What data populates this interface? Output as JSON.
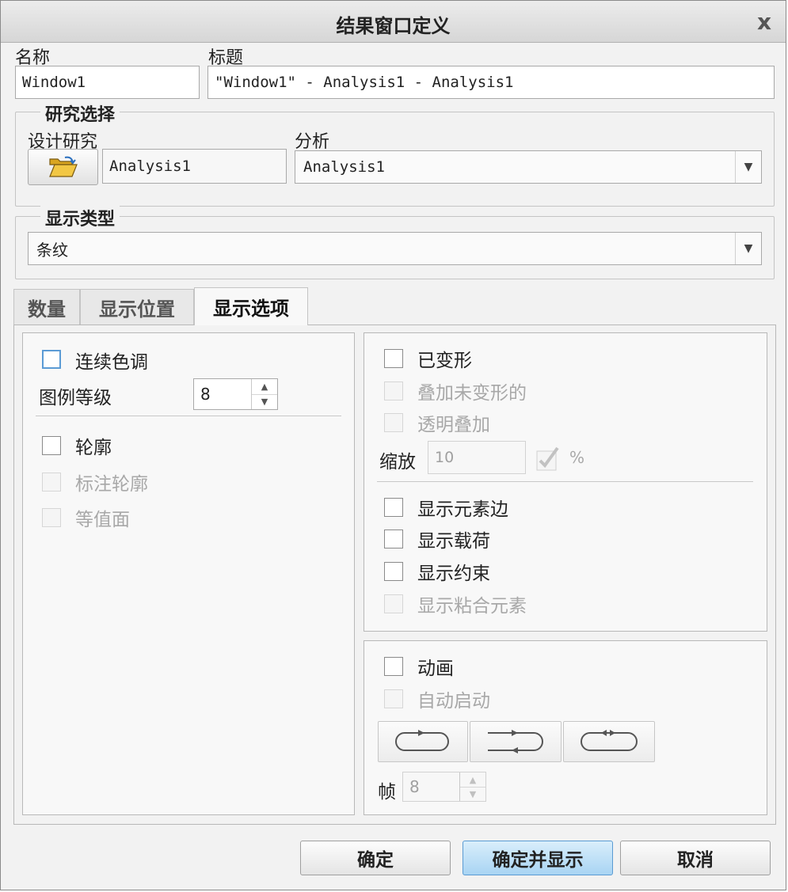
{
  "window": {
    "title": "结果窗口定义",
    "close_glyph": "x"
  },
  "name": {
    "label": "名称",
    "value": "Window1"
  },
  "heading": {
    "label": "标题",
    "value": "\"Window1\" - Analysis1 - Analysis1"
  },
  "study": {
    "group_title": "研究选择",
    "design_label": "设计研究",
    "design_value": "Analysis1",
    "analysis_label": "分析",
    "analysis_value": "Analysis1"
  },
  "display_type": {
    "group_title": "显示类型",
    "value": "条纹"
  },
  "tabs": [
    {
      "label": "数量",
      "active": false
    },
    {
      "label": "显示位置",
      "active": false
    },
    {
      "label": "显示选项",
      "active": true
    }
  ],
  "left": {
    "continuous_tone": "连续色调",
    "legend_levels_label": "图例等级",
    "legend_levels_value": "8",
    "contour": "轮廓",
    "label_contour": "标注轮廓",
    "isosurface": "等值面"
  },
  "right": {
    "deformed": "已变形",
    "overlay_undeformed": "叠加未变形的",
    "transparent_overlay": "透明叠加",
    "scale_label": "缩放",
    "scale_value": "10",
    "percent": "%",
    "show_element_edges": "显示元素边",
    "show_loads": "显示载荷",
    "show_constraints": "显示约束",
    "show_glued_elements": "显示粘合元素"
  },
  "animation": {
    "animate": "动画",
    "auto_start": "自动启动",
    "frames_label": "帧",
    "frames_value": "8"
  },
  "buttons": {
    "ok": "确定",
    "ok_show": "确定并显示",
    "cancel": "取消"
  },
  "colors": {
    "accent": "#5b9bd5",
    "primary_button": "#a8d4f3",
    "folder_icon": "#f2c744"
  }
}
